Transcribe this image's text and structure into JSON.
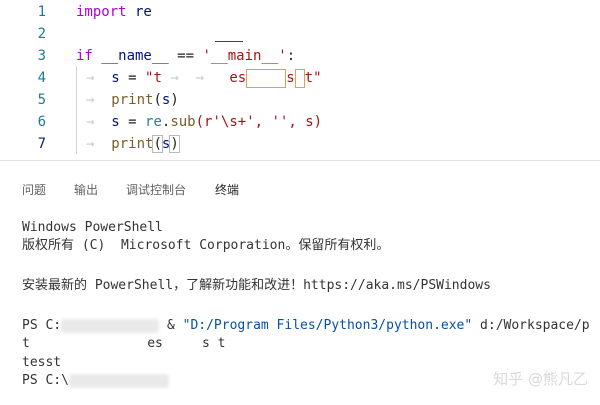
{
  "editor": {
    "lines": [
      {
        "num": "1",
        "t1": "import",
        "t2": " re"
      },
      {
        "num": "2"
      },
      {
        "num": "3",
        "t1": "if",
        "t2": " __name__",
        "t3": " == ",
        "t4": "'__main__'",
        "t5": ":"
      },
      {
        "num": "4",
        "t1": "s",
        "t2": " = ",
        "t3": "\"t",
        "t4": "es",
        "t5": "s",
        "t6": "t\""
      },
      {
        "num": "5",
        "t1": "print",
        "t2": "(",
        "t3": "s",
        "t4": ")"
      },
      {
        "num": "6",
        "t1": "s",
        "t2": " = ",
        "t3": "re",
        "t4": ".",
        "t5": "sub",
        "t6": "(r'\\s+', '', s)"
      },
      {
        "num": "7",
        "t1": "print",
        "t2": "(",
        "t3": "s",
        "t4": ")"
      }
    ],
    "tab_arrow": "→"
  },
  "panel": {
    "tabs": [
      {
        "label": "问题"
      },
      {
        "label": "输出"
      },
      {
        "label": "调试控制台"
      },
      {
        "label": "终端",
        "active": true
      }
    ]
  },
  "terminal": {
    "line1": "Windows PowerShell",
    "line2": "版权所有 (C)  Microsoft Corporation。保留所有权利。",
    "line3": "安装最新的 PowerShell，了解新功能和改进！https://aka.ms/PSWindows",
    "ps_prefix": "PS C:",
    "amp": " & ",
    "exe_path": "\"D:/Program Files/Python3/python.exe\"",
    "script_arg": " d:/Workspace/p",
    "out1": "t               es     s t",
    "out2": "tesst",
    "ps_prefix2": "PS C:\\"
  },
  "watermark": "知乎 @熊凡乙"
}
